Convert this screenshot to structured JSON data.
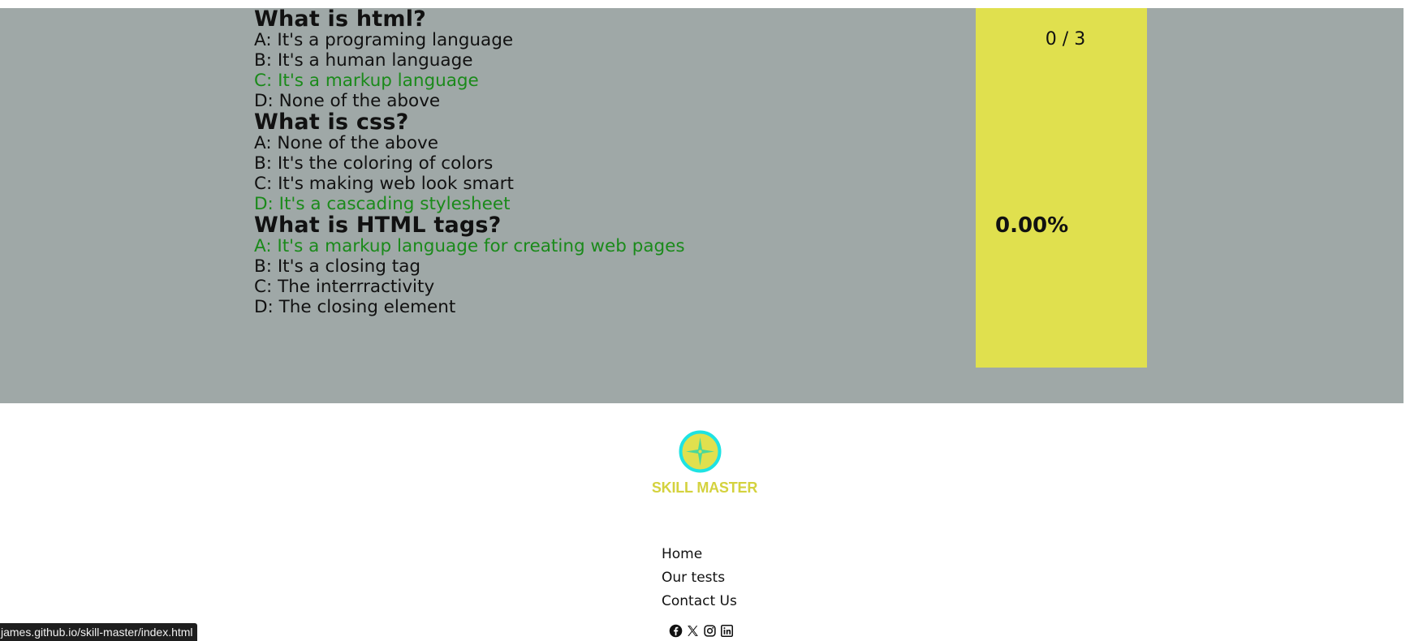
{
  "quiz": {
    "questions": [
      {
        "title": "What is html?",
        "answers": [
          {
            "text": "A: It's a programing language",
            "correct": false
          },
          {
            "text": "B: It's a human language",
            "correct": false
          },
          {
            "text": "C: It's a markup language",
            "correct": true
          },
          {
            "text": "D: None of the above",
            "correct": false
          }
        ]
      },
      {
        "title": "What is css?",
        "answers": [
          {
            "text": "A: None of the above",
            "correct": false
          },
          {
            "text": "B: It's the coloring of colors",
            "correct": false
          },
          {
            "text": "C: It's making web look smart",
            "correct": false
          },
          {
            "text": "D: It's a cascading stylesheet",
            "correct": true
          }
        ]
      },
      {
        "title": "What is HTML tags?",
        "answers": [
          {
            "text": "A: It's a markup language for creating web pages",
            "correct": true
          },
          {
            "text": "B: It's a closing tag",
            "correct": false
          },
          {
            "text": "C: The interrractivity",
            "correct": false
          },
          {
            "text": "D: The closing element",
            "correct": false
          }
        ]
      }
    ],
    "score": {
      "count": "0 / 3",
      "percent": "0.00%"
    }
  },
  "footer": {
    "brand": "SKILL MASTER",
    "nav": [
      "Home",
      "Our tests",
      "Contact Us"
    ],
    "socials": [
      "facebook-icon",
      "x-icon",
      "instagram-icon",
      "linkedin-icon"
    ]
  },
  "status_bar": {
    "url": "james.github.io/skill-master/index.html"
  },
  "colors": {
    "results_bg": "#9fa8a7",
    "score_panel": "#e0e04e",
    "correct_answer": "#1a8a1a",
    "brand": "#d4d23e",
    "logo_ring": "#1ee3e3"
  }
}
